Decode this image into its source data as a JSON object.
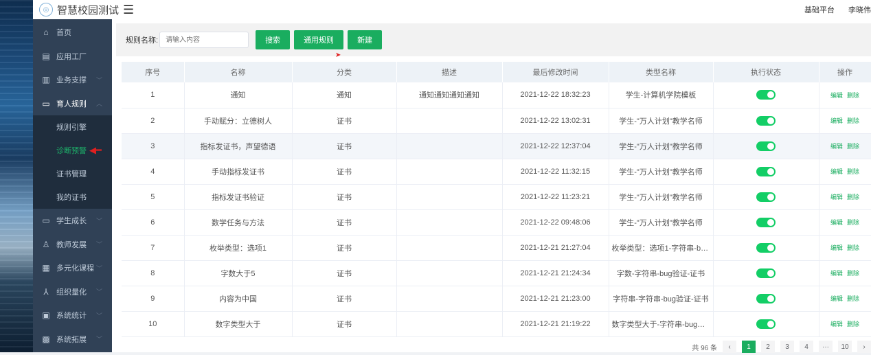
{
  "header": {
    "logo_glyph": "◎",
    "title": "智慧校园测试",
    "menu_glyph": "☰",
    "platform_link": "基础平台",
    "user_name": "李晓伟"
  },
  "sidebar": {
    "items": [
      {
        "label": "首页",
        "icon": "home-icon",
        "glyph": "⌂",
        "chev": ""
      },
      {
        "label": "应用工厂",
        "icon": "app-factory-icon",
        "glyph": "▤",
        "chev": ""
      },
      {
        "label": "业务支撑",
        "icon": "business-icon",
        "glyph": "▥",
        "chev": "﹀"
      },
      {
        "label": "育人规则",
        "icon": "rules-icon",
        "glyph": "▭",
        "chev": "︿"
      },
      {
        "label": "学生成长",
        "icon": "student-icon",
        "glyph": "▭",
        "chev": "﹀"
      },
      {
        "label": "教师发展",
        "icon": "teacher-icon",
        "glyph": "♙",
        "chev": "﹀"
      },
      {
        "label": "多元化课程",
        "icon": "course-icon",
        "glyph": "▦",
        "chev": "﹀"
      },
      {
        "label": "组织量化",
        "icon": "org-icon",
        "glyph": "⅄",
        "chev": "﹀"
      },
      {
        "label": "系统统计",
        "icon": "stats-icon",
        "glyph": "▣",
        "chev": "﹀"
      },
      {
        "label": "系统拓展",
        "icon": "extend-icon",
        "glyph": "▩",
        "chev": "﹀"
      }
    ],
    "sub_items": [
      "规则引擎",
      "诊断预警",
      "证书管理",
      "我的证书"
    ],
    "active_sub": "诊断预警"
  },
  "toolbar": {
    "rule_name_label": "规则名称:",
    "search_placeholder": "请输入内容",
    "search_button": "搜索",
    "common_rules_button": "通用规则",
    "new_button": "新建"
  },
  "table": {
    "headers": [
      "序号",
      "名称",
      "分类",
      "描述",
      "最后修改时间",
      "类型名称",
      "执行状态",
      "操作"
    ],
    "rows": [
      {
        "no": "1",
        "name": "通知",
        "category": "通知",
        "desc": "通知通知通知通知",
        "time": "2021-12-22 18:32:23",
        "type": "学生-计算机学院模板",
        "enabled": true
      },
      {
        "no": "2",
        "name": "手动赋分：立德树人",
        "category": "证书",
        "desc": "",
        "time": "2021-12-22 13:02:31",
        "type": "学生-\"万人计划\"教学名师",
        "enabled": true
      },
      {
        "no": "3",
        "name": "指标发证书，声望德语",
        "category": "证书",
        "desc": "",
        "time": "2021-12-22 12:37:04",
        "type": "学生-\"万人计划\"教学名师",
        "enabled": true
      },
      {
        "no": "4",
        "name": "手动指标发证书",
        "category": "证书",
        "desc": "",
        "time": "2021-12-22 11:32:15",
        "type": "学生-\"万人计划\"教学名师",
        "enabled": true
      },
      {
        "no": "5",
        "name": "指标发证书验证",
        "category": "证书",
        "desc": "",
        "time": "2021-12-22 11:23:21",
        "type": "学生-\"万人计划\"教学名师",
        "enabled": true
      },
      {
        "no": "6",
        "name": "数学任务与方法",
        "category": "证书",
        "desc": "",
        "time": "2021-12-22 09:48:06",
        "type": "学生-\"万人计划\"教学名师",
        "enabled": true
      },
      {
        "no": "7",
        "name": "枚举类型：选项1",
        "category": "证书",
        "desc": "",
        "time": "2021-12-21 21:27:04",
        "type": "枚举类型：选项1-字符串-bug验...",
        "enabled": true
      },
      {
        "no": "8",
        "name": "字数大于5",
        "category": "证书",
        "desc": "",
        "time": "2021-12-21 21:24:34",
        "type": "字数-字符串-bug验证-证书",
        "enabled": true
      },
      {
        "no": "9",
        "name": "内容为中国",
        "category": "证书",
        "desc": "",
        "time": "2021-12-21 21:23:00",
        "type": "字符串-字符串-bug验证-证书",
        "enabled": true
      },
      {
        "no": "10",
        "name": "数字类型大于",
        "category": "证书",
        "desc": "",
        "time": "2021-12-21 21:19:22",
        "type": "数字类型大于-字符串-bug验证-...",
        "enabled": true
      }
    ],
    "edit_label": "编辑",
    "delete_label": "删除"
  },
  "pagination": {
    "total_text": "共 96 条",
    "prev": "‹",
    "pages": [
      "1",
      "2",
      "3",
      "4"
    ],
    "ellipsis": "···",
    "last": "10",
    "next": "›",
    "current": "1"
  },
  "colors": {
    "accent": "#1aad5f",
    "sidebar_bg": "#304156",
    "toggle_on": "#13ce66"
  }
}
